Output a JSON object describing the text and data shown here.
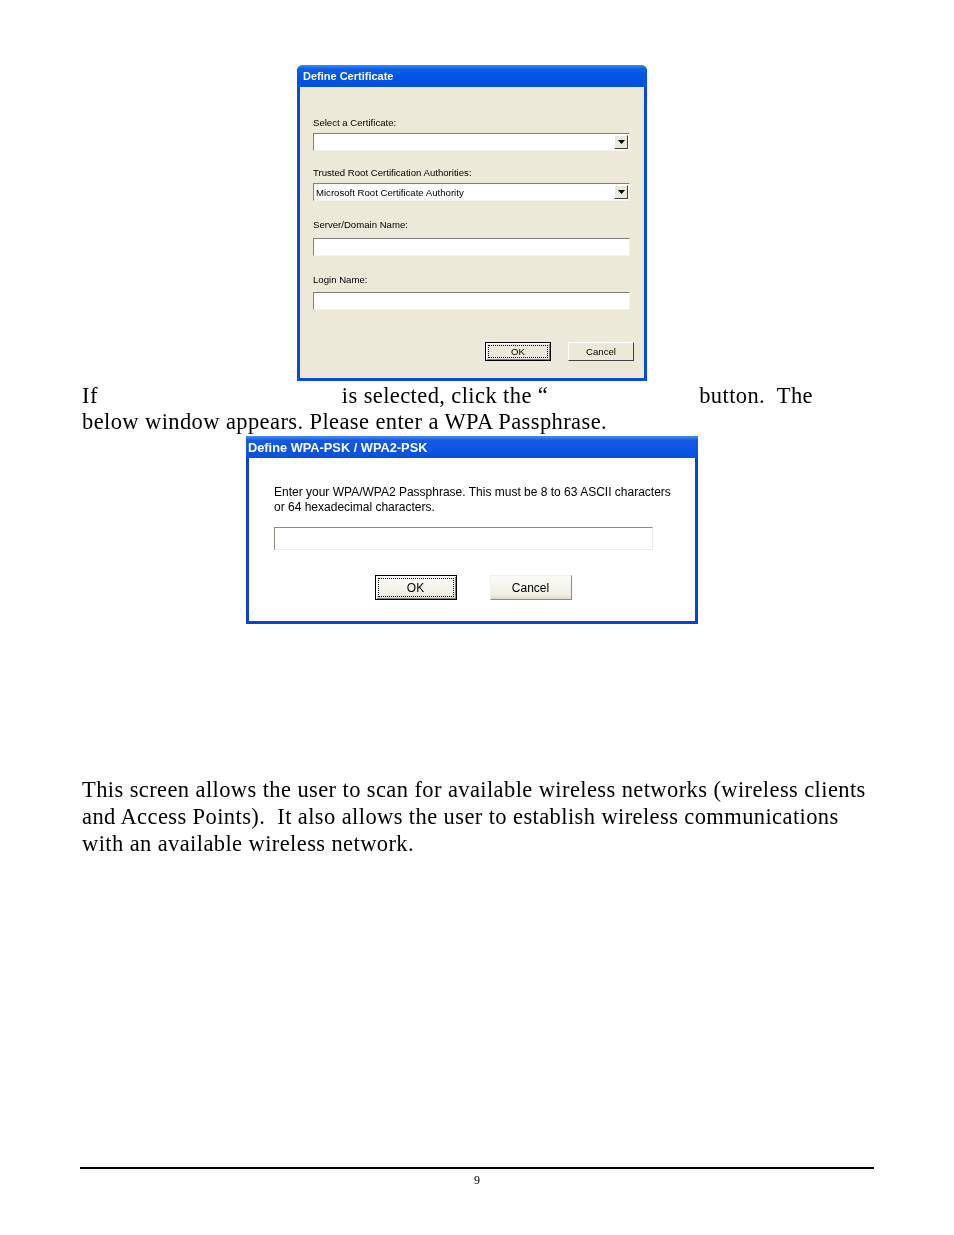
{
  "certificate_dialog": {
    "title": "Define Certificate",
    "fields": [
      {
        "kind": "dropdown",
        "label": "Select a Certificate:"
      },
      {
        "kind": "dropdown",
        "label": "Trusted Root Certification Authorities:",
        "value": "Microsoft Root Certificate Authority"
      },
      {
        "kind": "text",
        "label": "Server/Domain Name:"
      },
      {
        "kind": "text",
        "label": "Login Name:"
      }
    ],
    "buttons": [
      {
        "label": "OK",
        "default": true
      },
      {
        "label": "Cancel",
        "default": false
      }
    ]
  },
  "instruction": {
    "segments": [
      "If",
      "is selected, click the “",
      "button.  The below window appears. Please enter a WPA Passphrase."
    ]
  },
  "passphrase_dialog": {
    "title": "Define WPA-PSK / WPA2-PSK",
    "message": "Enter your WPA/WPA2 Passphrase. This must be 8 to 63 ASCII characters or 64 hexadecimal characters.",
    "buttons": [
      {
        "label": "OK",
        "default": true
      },
      {
        "label": "Cancel",
        "default": false
      }
    ]
  },
  "description": "This screen allows the user to scan for available wireless networks (wireless clients and Access Points).  It also allows the user to establish wireless communications with an available wireless network.",
  "footer": {
    "page_number": "9"
  }
}
